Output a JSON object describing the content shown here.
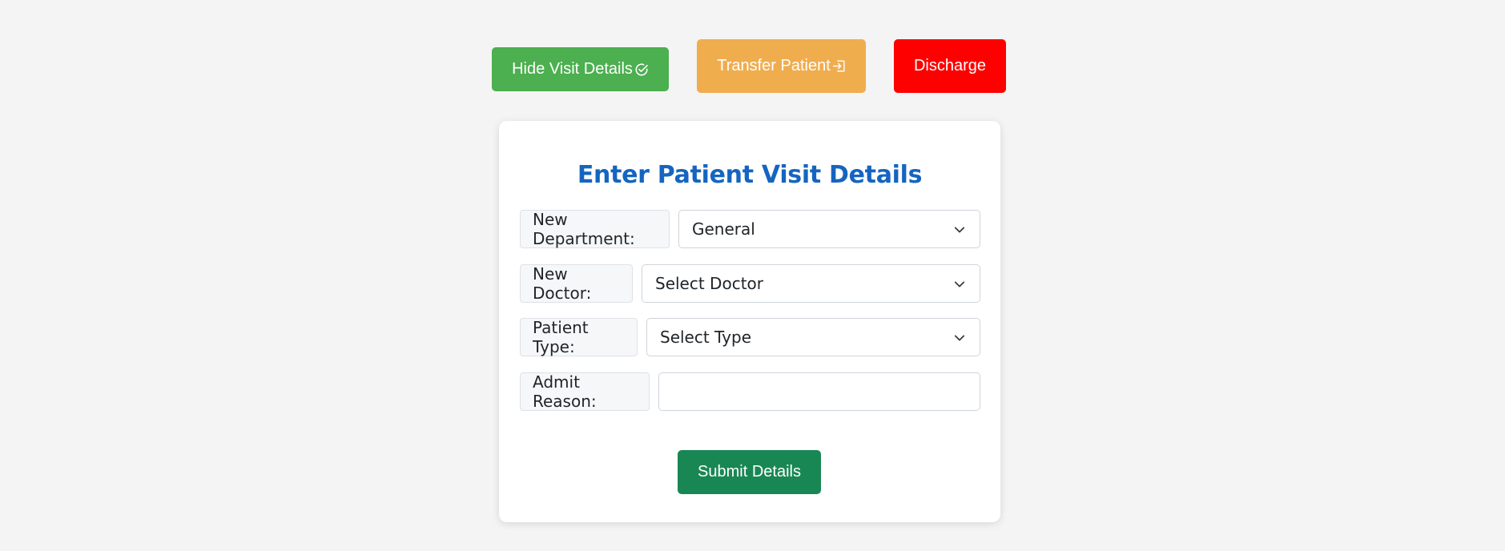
{
  "actions": {
    "hide_label": "Hide Visit Details",
    "hide_icon": "check-circle-icon",
    "transfer_label": "Transfer Patient",
    "transfer_icon": "sign-in-icon",
    "discharge_label": "Discharge"
  },
  "form": {
    "title": "Enter Patient Visit Details",
    "department": {
      "label": "New Department:",
      "value": "General"
    },
    "doctor": {
      "label": "New Doctor:",
      "value": "Select Doctor"
    },
    "patient_type": {
      "label": "Patient Type:",
      "value": "Select Type"
    },
    "admit_reason": {
      "label": "Admit Reason:",
      "value": "",
      "placeholder": ""
    },
    "submit_label": "Submit Details"
  },
  "colors": {
    "background": "#f4f4f4",
    "hide_button": "#4caf50",
    "transfer_button": "#f0ad4e",
    "discharge_button": "#ff0000",
    "title": "#1565c0",
    "submit_button": "#198754"
  }
}
